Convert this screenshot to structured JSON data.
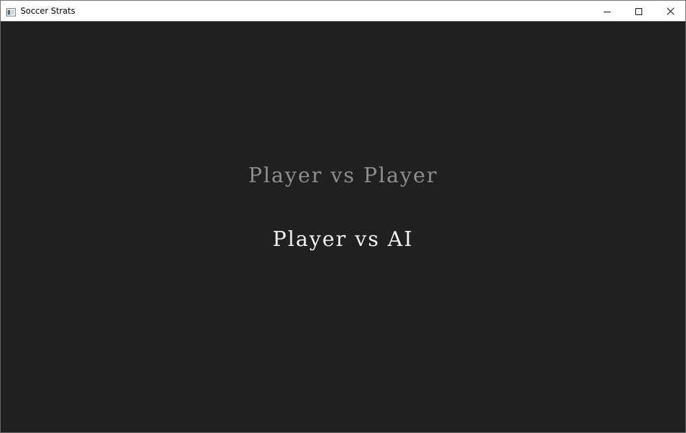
{
  "window": {
    "title": "Soccer Strats",
    "icon": "app-window-icon",
    "controls": {
      "minimize": "minimize-icon",
      "maximize": "maximize-icon",
      "close": "close-icon"
    }
  },
  "menu": {
    "options": [
      {
        "label": "Player vs Player",
        "color": "#8e8e8e"
      },
      {
        "label": "Player vs AI",
        "color": "#f2f2f2"
      }
    ]
  },
  "colors": {
    "background": "#202020",
    "titlebar": "#ffffff"
  }
}
